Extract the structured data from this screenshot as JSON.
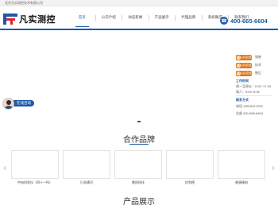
{
  "topbar": {
    "company": "北京凡实测控技术有限公司"
  },
  "logo": {
    "text": "凡实测控"
  },
  "nav": {
    "items": [
      {
        "label": "首页",
        "active": true
      },
      {
        "label": "公司介绍"
      },
      {
        "label": "动态新闻"
      },
      {
        "label": "产品展示"
      },
      {
        "label": "代理品牌"
      },
      {
        "label": "系统集成"
      },
      {
        "label": "联系我们"
      }
    ]
  },
  "hotline": {
    "number": "400-665-6604",
    "icon": "phone-icon"
  },
  "online": {
    "label": "在线咨询"
  },
  "service": {
    "qq_text": "QQ交谈",
    "rows": [
      {
        "label": "销售"
      },
      {
        "label": "技术"
      },
      {
        "label": "售后"
      }
    ],
    "hours_title": "工作时间",
    "hours_1": "周一至周五：8:30~17:30",
    "hours_2": "周六：9:00~6:30",
    "contact_title": "联系方式",
    "phone": "电话:13510917293",
    "tel": "总部:400-665-6604"
  },
  "brands_section": {
    "title": "合作品牌",
    "prev": "‹",
    "next": "›",
    "items": [
      {
        "name": "中电科思仪（四十一所）"
      },
      {
        "name": "日本横河"
      },
      {
        "name": "鼎阳科技"
      },
      {
        "name": "优利德"
      },
      {
        "name": "普源精电"
      }
    ]
  },
  "products_section": {
    "title": "产品展示"
  },
  "colors": {
    "brand_blue": "#1a5aa8",
    "logo_red": "#d7262e",
    "qq_orange": "#e07a1a"
  }
}
